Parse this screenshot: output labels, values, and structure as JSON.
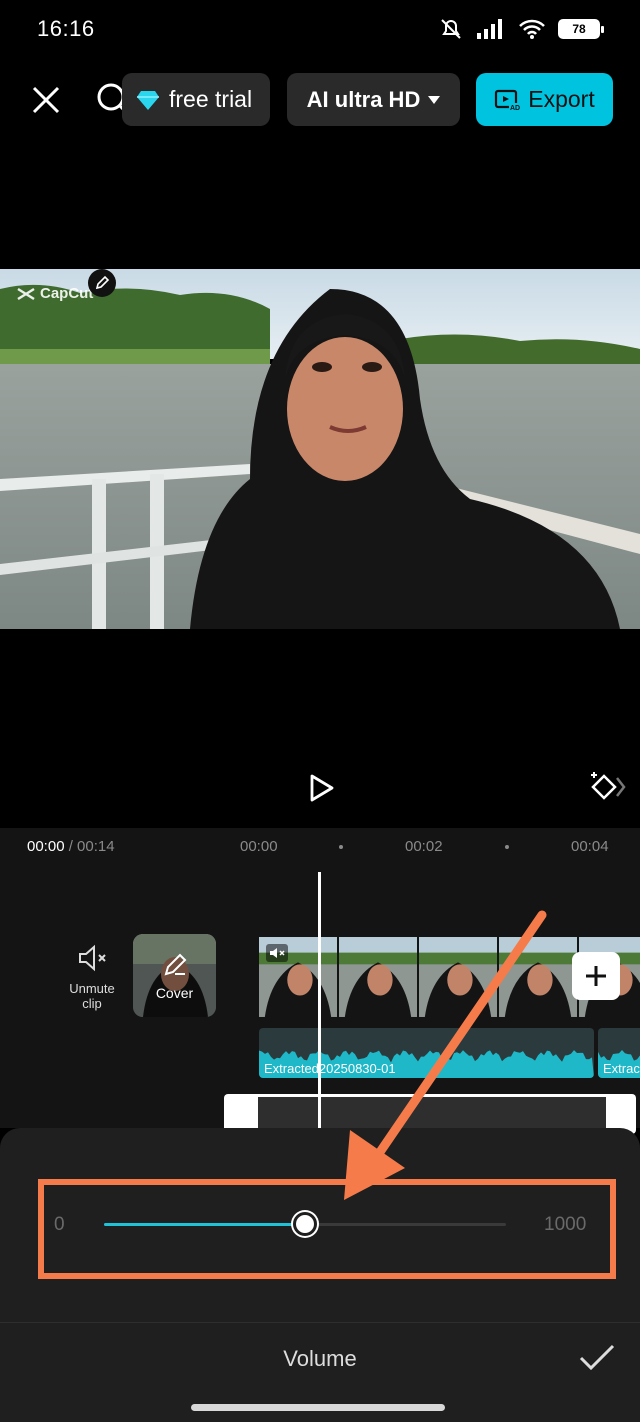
{
  "status_bar": {
    "time": "16:16",
    "battery": "78"
  },
  "toolbar": {
    "free_trial_label": "free trial",
    "quality_label": "AI ultra HD",
    "export_label": "Export"
  },
  "video": {
    "watermark": "CapCut"
  },
  "timeline": {
    "current_time": "00:00",
    "total_time": "/ 00:14",
    "ticks": [
      "00:00",
      "00:02",
      "00:04"
    ],
    "unmute_label_line1": "Unmute",
    "unmute_label_line2": "clip",
    "cover_label": "Cover",
    "audio_track_label": "Extracted20250830-01",
    "audio_track2_label": "Extrac"
  },
  "volume_panel": {
    "min_label": "0",
    "max_label": "1000",
    "value_fraction": 0.5,
    "title": "Volume"
  },
  "colors": {
    "accent": "#00c3e0",
    "slider_fill": "#1fc3d8",
    "annotation": "#f57c4a",
    "waveform": "#1fb8c8"
  }
}
